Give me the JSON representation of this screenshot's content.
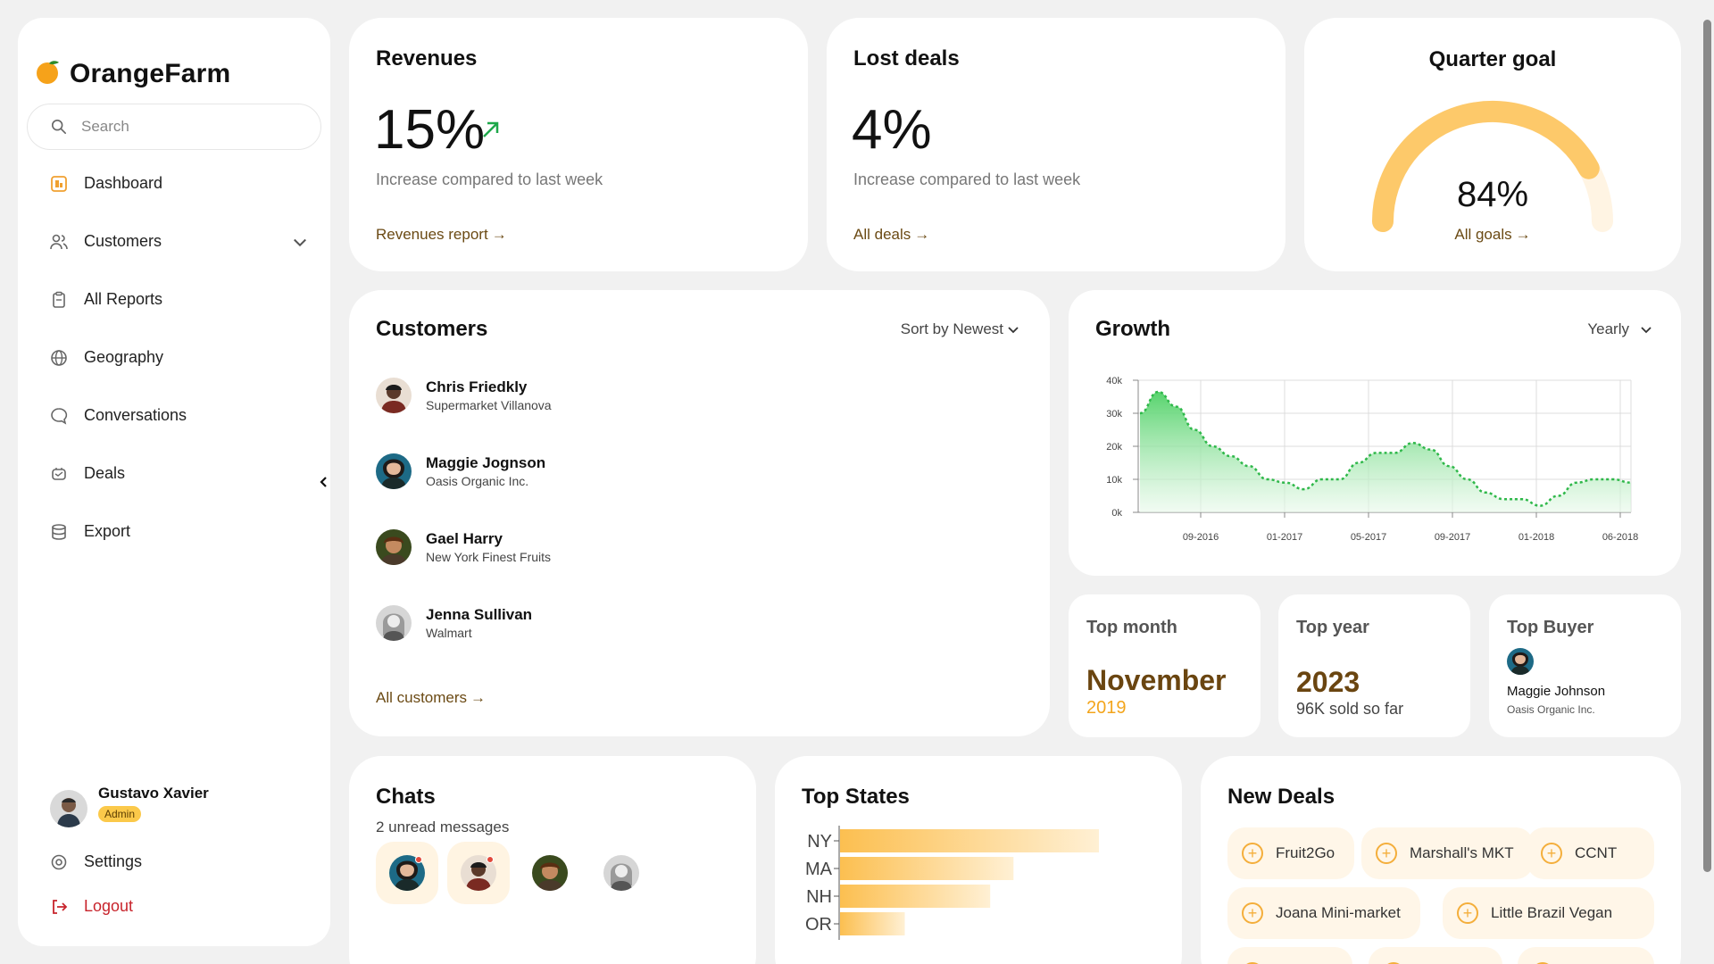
{
  "app": {
    "name": "OrangeFarm"
  },
  "search": {
    "placeholder": "Search"
  },
  "nav": [
    {
      "label": "Dashboard",
      "icon": "dashboard-icon"
    },
    {
      "label": "Customers",
      "icon": "users-icon"
    },
    {
      "label": "All Reports",
      "icon": "clipboard-icon"
    },
    {
      "label": "Geography",
      "icon": "globe-icon"
    },
    {
      "label": "Conversations",
      "icon": "chat-bubble-icon"
    },
    {
      "label": "Deals",
      "icon": "handshake-icon"
    },
    {
      "label": "Export",
      "icon": "database-icon"
    }
  ],
  "user": {
    "name": "Gustavo Xavier",
    "role": "Admin"
  },
  "footer_nav": {
    "settings": "Settings",
    "logout": "Logout"
  },
  "revenues": {
    "title": "Revenues",
    "value": "15%",
    "subtitle": "Increase compared to last week",
    "link": "Revenues report"
  },
  "lost_deals": {
    "title": "Lost deals",
    "value": "4%",
    "subtitle": "Increase compared to last week",
    "link": "All deals"
  },
  "quarter_goal": {
    "title": "Quarter goal",
    "value": "84%",
    "progress": 0.84,
    "link": "All goals"
  },
  "customers": {
    "title": "Customers",
    "sort": "Sort by Newest",
    "items": [
      {
        "name": "Chris Friedkly",
        "company": "Supermarket Villanova"
      },
      {
        "name": "Maggie Jognson",
        "company": "Oasis Organic Inc."
      },
      {
        "name": "Gael Harry",
        "company": "New York Finest Fruits"
      },
      {
        "name": "Jenna Sullivan",
        "company": "Walmart"
      }
    ],
    "link": "All customers"
  },
  "growth": {
    "title": "Growth",
    "period": "Yearly"
  },
  "chart_data": {
    "type": "area",
    "x_tick_labels": [
      "09-2016",
      "01-2017",
      "05-2017",
      "09-2017",
      "01-2018",
      "06-2018"
    ],
    "y_tick_labels": [
      "0k",
      "10k",
      "20k",
      "30k",
      "40k"
    ],
    "ylim": [
      0,
      40000
    ],
    "series": [
      {
        "values": [
          30000,
          36500,
          32000,
          25000,
          20000,
          17000,
          14000,
          10000,
          9000,
          7000,
          10000,
          10000,
          15000,
          18000,
          18000,
          21000,
          19000,
          14000,
          10000,
          6000,
          4000,
          4000,
          2000,
          5000,
          9000,
          10000,
          10000,
          9000
        ]
      }
    ],
    "grid": true,
    "color": "#2fb84a"
  },
  "top_month": {
    "title": "Top month",
    "value": "November",
    "sub": "2019"
  },
  "top_year": {
    "title": "Top year",
    "value": "2023",
    "sub": "96K sold so far"
  },
  "top_buyer": {
    "title": "Top Buyer",
    "name": "Maggie Johnson",
    "company": "Oasis Organic Inc."
  },
  "chats": {
    "title": "Chats",
    "subtitle": "2 unread messages"
  },
  "top_states": {
    "title": "Top States",
    "items": [
      {
        "label": "NY",
        "value": 1.0
      },
      {
        "label": "MA",
        "value": 0.67
      },
      {
        "label": "NH",
        "value": 0.58
      },
      {
        "label": "OR",
        "value": 0.25
      }
    ]
  },
  "new_deals": {
    "title": "New Deals",
    "items": [
      "Fruit2Go",
      "Marshall's MKT",
      "CCNT",
      "Joana Mini-market",
      "Little Brazil Vegan"
    ]
  },
  "colors": {
    "accent": "#f6a21a",
    "gauge": "#fdc96a",
    "link": "#6b4a14",
    "logout": "#c8242c"
  }
}
